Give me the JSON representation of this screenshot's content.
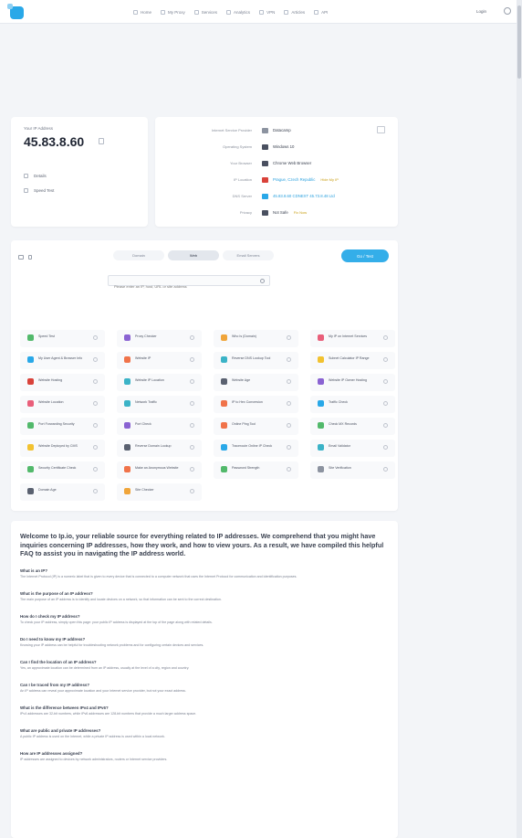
{
  "nav": {
    "items": [
      {
        "label": "Home",
        "icon": "home-icon"
      },
      {
        "label": "My Proxy",
        "icon": "proxy-icon"
      },
      {
        "label": "Services",
        "icon": "services-icon"
      },
      {
        "label": "Analytics",
        "icon": "analytics-icon"
      },
      {
        "label": "VPN",
        "icon": "vpn-icon"
      },
      {
        "label": "Articles",
        "icon": "articles-icon"
      },
      {
        "label": "API",
        "icon": "api-icon"
      }
    ],
    "login": "Login"
  },
  "ip_card": {
    "label": "Your IP Address",
    "ip": "45.83.8.60",
    "rows": [
      {
        "label": "Details"
      },
      {
        "label": "Speed Test"
      }
    ]
  },
  "details": {
    "rows": [
      {
        "label": "Internet Service Provider",
        "value": "Datacamp",
        "link": false,
        "badge": "",
        "color": "#8c93a0"
      },
      {
        "label": "Operating System",
        "value": "Windows 10",
        "link": false,
        "badge": "",
        "color": "#4a5060"
      },
      {
        "label": "Your Browser",
        "value": "Chrome Web Browser",
        "link": false,
        "badge": "",
        "color": "#4a5060"
      },
      {
        "label": "IP Location",
        "value": "Prague, Czech Republic",
        "link": true,
        "badge": "Hide My IP",
        "color": "#d9423a"
      },
      {
        "label": "DNS Server",
        "value": "45.83.8.60 CDNEXT 45.73.8.48 Ltd",
        "link": true,
        "badge": "",
        "color": "#29a8e8"
      },
      {
        "label": "Privacy",
        "value": "Not Safe",
        "link": false,
        "badge": "Fix Now",
        "color": "#4a5060"
      }
    ]
  },
  "tools": {
    "tabs": [
      {
        "label": "Domain",
        "active": false
      },
      {
        "label": "Web",
        "active": true
      },
      {
        "label": "Email Servers",
        "active": false
      }
    ],
    "go_label": "Go / Test",
    "search_placeholder": "Please enter an IP, host, URL or site address",
    "items": [
      {
        "label": "Speed Test",
        "color": "#52b96b"
      },
      {
        "label": "Proxy Checker",
        "color": "#8a63d2"
      },
      {
        "label": "Who Is (Domain)",
        "color": "#f0a53a"
      },
      {
        "label": "My IP on Internet Services",
        "color": "#e95f7a"
      },
      {
        "label": "My User Agent & Browser Info",
        "color": "#29a8e8"
      },
      {
        "label": "Website IP",
        "color": "#f0734a"
      },
      {
        "label": "Reverse DNS Lookup Tool",
        "color": "#3bb3c7"
      },
      {
        "label": "Subnet Calculator IP Range",
        "color": "#f2c230"
      },
      {
        "label": "Website Hosting",
        "color": "#d9423a"
      },
      {
        "label": "Website IP Location",
        "color": "#3bb3c7"
      },
      {
        "label": "Website Age",
        "color": "#5a6170"
      },
      {
        "label": "Website IP Owner Hosting",
        "color": "#8a63d2"
      },
      {
        "label": "Website Location",
        "color": "#e95f7a"
      },
      {
        "label": "Network Traffic",
        "color": "#3bb3c7"
      },
      {
        "label": "IP to Hex Conversion",
        "color": "#f0734a"
      },
      {
        "label": "Traffic Check",
        "color": "#29a8e8"
      },
      {
        "label": "Port Forwarding Security",
        "color": "#52b96b"
      },
      {
        "label": "Port Check",
        "color": "#8a63d2"
      },
      {
        "label": "Online Ping Tool",
        "color": "#f0734a"
      },
      {
        "label": "Check MX Records",
        "color": "#52b96b"
      },
      {
        "label": "Website Deployed by CMS",
        "color": "#f2c230"
      },
      {
        "label": "Reverse Domain Lookup",
        "color": "#5a6170"
      },
      {
        "label": "Traceroute Online IP Check",
        "color": "#29a8e8"
      },
      {
        "label": "Email Validator",
        "color": "#3bb3c7"
      },
      {
        "label": "Security Certificate Check",
        "color": "#52b96b"
      },
      {
        "label": "Make an Anonymous Website",
        "color": "#f0734a"
      },
      {
        "label": "Password Strength",
        "color": "#52b96b"
      },
      {
        "label": "Site Verification",
        "color": "#8c93a0"
      },
      {
        "label": "Domain Age",
        "color": "#5a6170"
      },
      {
        "label": "Site Checker",
        "color": "#f0a53a"
      }
    ]
  },
  "faq": {
    "intro": "Welcome to Ip.io, your reliable source for everything related to IP addresses. We comprehend that you might have inquiries concerning IP addresses, how they work, and how to view yours. As a result, we have compiled this helpful FAQ to assist you in navigating the IP address world.",
    "items": [
      {
        "q": "What is an IP?",
        "a": "The Internet Protocol (IP) is a numeric label that is given to every device that is connected to a computer network that uses the Internet Protocol for communication and identification purposes."
      },
      {
        "q": "What is the purpose of an IP address?",
        "a": "The main purpose of an IP address is to identify and locate devices on a network, so that information can be sent to the correct destination."
      },
      {
        "q": "How do I check my IP address?",
        "a": "To check your IP address, simply open this page: your public IP address is displayed at the top of the page along with related details."
      },
      {
        "q": "Do I need to know my IP address?",
        "a": "Knowing your IP address can be helpful for troubleshooting network problems and for configuring certain devices and services."
      },
      {
        "q": "Can I find the location of an IP address?",
        "a": "Yes, an approximate location can be determined from an IP address, usually at the level of a city, region and country."
      },
      {
        "q": "Can I be traced from my IP address?",
        "a": "An IP address can reveal your approximate location and your Internet service provider, but not your exact address."
      },
      {
        "q": "What is the difference between IPv4 and IPv6?",
        "a": "IPv4 addresses are 32-bit numbers, while IPv6 addresses are 128-bit numbers that provide a much larger address space."
      },
      {
        "q": "What are public and private IP addresses?",
        "a": "A public IP address is used on the Internet, while a private IP address is used within a local network."
      },
      {
        "q": "How are IP addresses assigned?",
        "a": "IP addresses are assigned to devices by network administrators, routers or Internet service providers."
      }
    ]
  }
}
